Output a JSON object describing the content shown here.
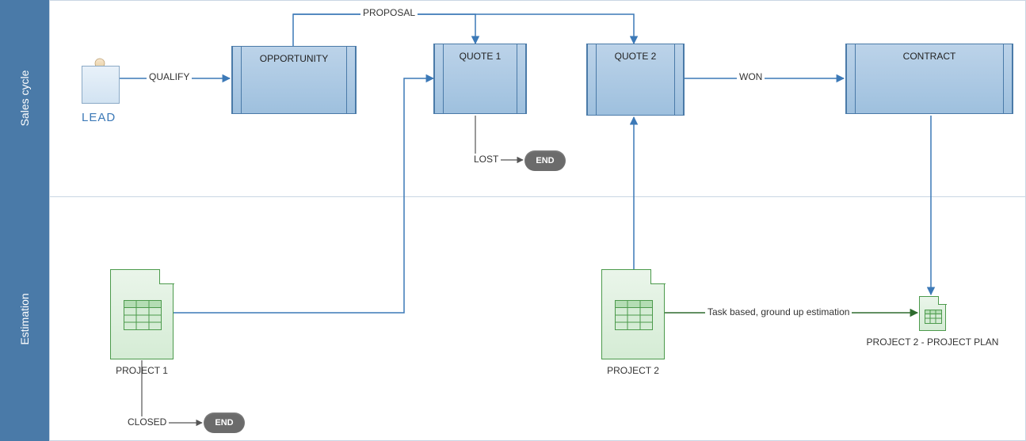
{
  "lanes": {
    "sales": "Sales cycle",
    "estimation": "Estimation"
  },
  "nodes": {
    "lead": "LEAD",
    "opportunity": "OPPORTUNITY",
    "quote1": "QUOTE 1",
    "quote2": "QUOTE 2",
    "contract": "CONTRACT",
    "project1": "PROJECT 1",
    "project2": "PROJECT 2",
    "project2plan": "PROJECT 2 - PROJECT PLAN",
    "end": "END"
  },
  "edges": {
    "qualify": "QUALIFY",
    "proposal": "PROPOSAL",
    "lost": "LOST",
    "won": "WON",
    "closed": "CLOSED",
    "task_based": "Task based, ground up estimation"
  }
}
